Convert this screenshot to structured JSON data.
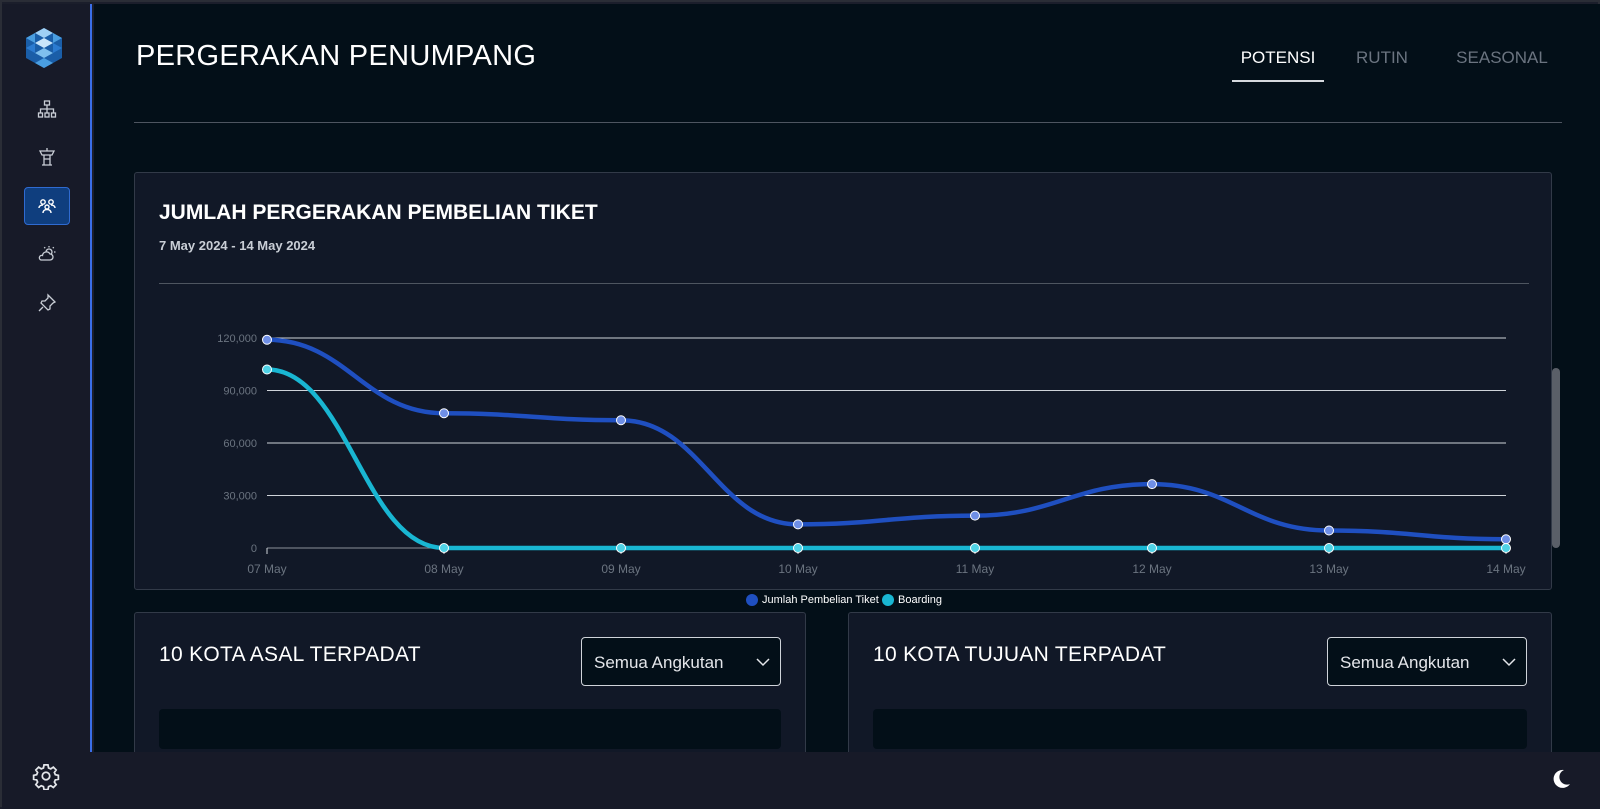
{
  "page": {
    "title": "PERGERAKAN PENUMPANG"
  },
  "tabs": [
    {
      "label": "POTENSI",
      "active": true
    },
    {
      "label": "RUTIN",
      "active": false
    },
    {
      "label": "SEASONAL",
      "active": false
    }
  ],
  "sidebar": {
    "items": [
      {
        "icon": "hierarchy-icon",
        "active": false
      },
      {
        "icon": "control-tower-icon",
        "active": false
      },
      {
        "icon": "passengers-icon",
        "active": true
      },
      {
        "icon": "weather-icon",
        "active": false
      },
      {
        "icon": "pin-icon",
        "active": false
      }
    ]
  },
  "chart": {
    "title": "JUMLAH PERGERAKAN PEMBELIAN TIKET",
    "subtitle": "7 May 2024 - 14 May 2024"
  },
  "chart_data": {
    "type": "line",
    "categories": [
      "07 May",
      "08 May",
      "09 May",
      "10 May",
      "11 May",
      "12 May",
      "13 May",
      "14 May"
    ],
    "series": [
      {
        "name": "Jumlah Pembelian Tiket",
        "color": "#1f4fc0",
        "values": [
          119000,
          77000,
          73000,
          13500,
          18500,
          36500,
          10000,
          5000
        ]
      },
      {
        "name": "Boarding",
        "color": "#19b6d2",
        "values": [
          102000,
          0,
          0,
          0,
          0,
          0,
          0,
          0
        ]
      }
    ],
    "ylim": [
      0,
      120000
    ],
    "yticks": [
      0,
      30000,
      60000,
      90000,
      120000
    ],
    "ytick_labels": [
      "0",
      "30,000",
      "60,000",
      "90,000",
      "120,000"
    ],
    "grid": true,
    "legend": "bottom-center"
  },
  "origin": {
    "title": "10 KOTA ASAL TERPADAT",
    "select_value": "Semua Angkutan"
  },
  "destination": {
    "title": "10 KOTA TUJUAN TERPADAT",
    "select_value": "Semua Angkutan"
  },
  "colors": {
    "accent": "#3a6ee8",
    "background": "#030f18",
    "card": "#111827"
  }
}
